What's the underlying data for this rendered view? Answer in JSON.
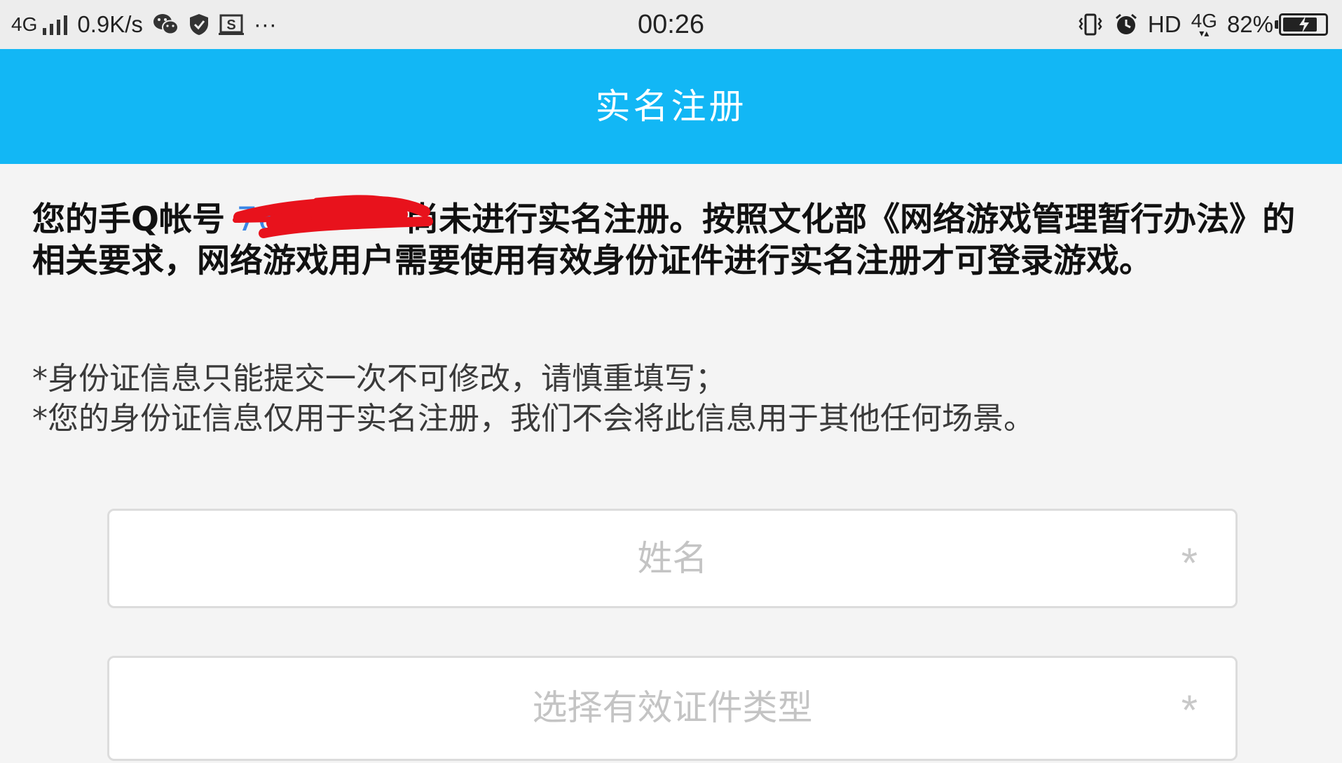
{
  "status_bar": {
    "network_type": "4G",
    "net_speed": "0.9K/s",
    "icons_left": [
      "signal-icon",
      "wechat-icon",
      "shield-icon",
      "screenshot-icon",
      "more-dots-icon"
    ],
    "more": "···",
    "time": "00:26",
    "icons_right": [
      "vibrate-icon",
      "alarm-icon",
      "battery-icon"
    ],
    "hd_label": "HD",
    "network_type_right": "4G",
    "battery_percent": "82%",
    "battery_level": 0.82
  },
  "header": {
    "title": "实名注册"
  },
  "notice": {
    "prefix": "您的手Q帐号 ",
    "account": "76",
    "suffix": "尚未进行实名注册。按照文化部《网络游戏管理暂行办法》的相关要求，网络游戏用户需要使用有效身份证件进行实名注册才可登录游戏。"
  },
  "notes": [
    "*身份证信息只能提交一次不可修改，请慎重填写；",
    "*您的身份证信息仅用于实名注册，我们不会将此信息用于其他任何场景。"
  ],
  "form": {
    "name_placeholder": "姓名",
    "id_type_placeholder": "选择有效证件类型",
    "required_mark": "*"
  },
  "colors": {
    "title_bar": "#12b7f5",
    "account_link": "#3a86e6",
    "redaction": "#e8121c"
  }
}
